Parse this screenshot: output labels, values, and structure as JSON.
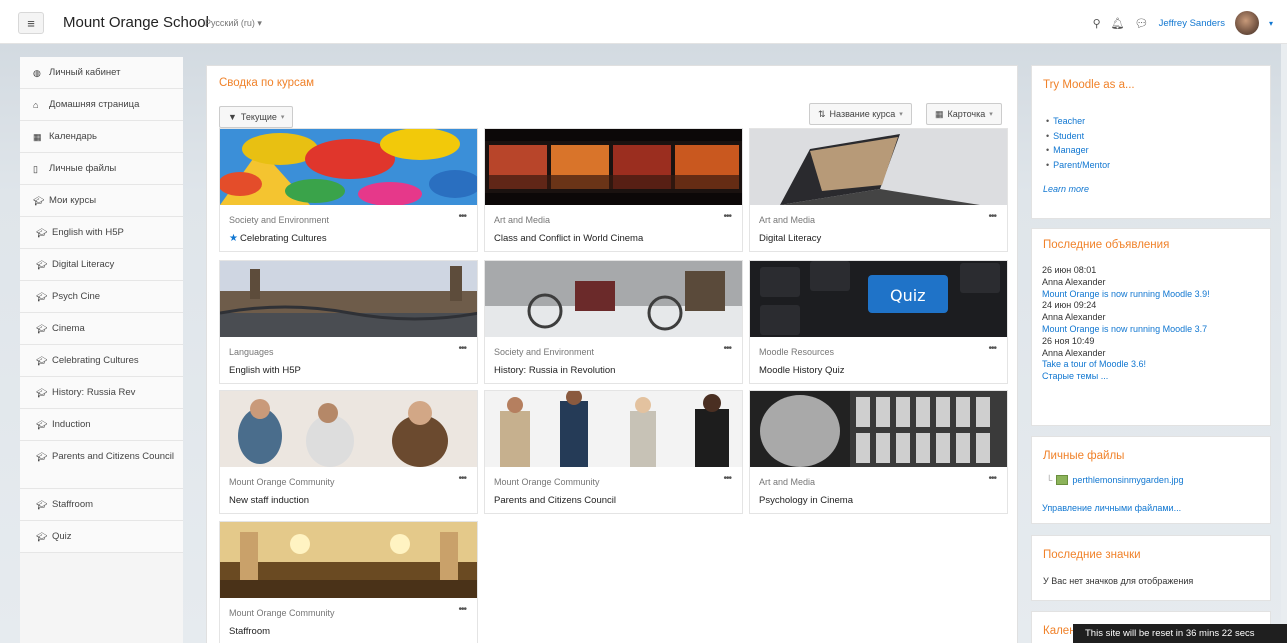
{
  "header": {
    "brand": "Mount Orange School",
    "language": "Русский (ru)",
    "username": "Jeffrey Sanders",
    "menu_icon": "hamburger-icon",
    "icons": [
      "search-icon",
      "bell-icon",
      "chat-icon"
    ]
  },
  "sidebar": {
    "items": [
      {
        "label": "Личный кабинет",
        "icon": "dashboard-icon"
      },
      {
        "label": "Домашняя страница",
        "icon": "home-icon"
      },
      {
        "label": "Календарь",
        "icon": "calendar-icon"
      },
      {
        "label": "Личные файлы",
        "icon": "file-icon"
      },
      {
        "label": "Мои курсы",
        "icon": "graduation-cap-icon"
      },
      {
        "label": "English with H5P",
        "icon": "graduation-cap-icon"
      },
      {
        "label": "Digital Literacy",
        "icon": "graduation-cap-icon"
      },
      {
        "label": "Psych Cine",
        "icon": "graduation-cap-icon"
      },
      {
        "label": "Cinema",
        "icon": "graduation-cap-icon"
      },
      {
        "label": "Celebrating Cultures",
        "icon": "graduation-cap-icon"
      },
      {
        "label": "History: Russia Rev",
        "icon": "graduation-cap-icon"
      },
      {
        "label": "Induction",
        "icon": "graduation-cap-icon"
      },
      {
        "label": "Parents and Citizens Council",
        "icon": "graduation-cap-icon"
      },
      {
        "label": "Staffroom",
        "icon": "graduation-cap-icon"
      },
      {
        "label": "Quiz",
        "icon": "graduation-cap-icon"
      }
    ]
  },
  "main": {
    "title": "Сводка по курсам",
    "filter_label": "Текущие",
    "sort_label": "Название курса",
    "view_label": "Карточка",
    "courses": [
      {
        "category": "Society and Environment",
        "name": "Celebrating Cultures",
        "starred": true
      },
      {
        "category": "Art and Media",
        "name": "Class and Conflict in World Cinema"
      },
      {
        "category": "Art and Media",
        "name": "Digital Literacy"
      },
      {
        "category": "Languages",
        "name": "English with H5P"
      },
      {
        "category": "Society and Environment",
        "name": "History: Russia in Revolution"
      },
      {
        "category": "Moodle Resources",
        "name": "Moodle History Quiz"
      },
      {
        "category": "Mount Orange Community",
        "name": "New staff induction"
      },
      {
        "category": "Mount Orange Community",
        "name": "Parents and Citizens Council"
      },
      {
        "category": "Art and Media",
        "name": "Psychology in Cinema"
      },
      {
        "category": "Mount Orange Community",
        "name": "Staffroom"
      }
    ],
    "quiz_key_label": "Quiz"
  },
  "blocks": {
    "try_moodle": {
      "title": "Try Moodle as a...",
      "roles": [
        "Teacher",
        "Student",
        "Manager",
        "Parent/Mentor"
      ],
      "learn_more": "Learn more"
    },
    "announcements": {
      "title": "Последние объявления",
      "items": [
        {
          "date": "26 июн 08:01",
          "author": "Anna Alexander",
          "subject": "Mount Orange is now running Moodle 3.9!"
        },
        {
          "date": "24 июн 09:24",
          "author": "Anna Alexander",
          "subject": "Mount Orange is now running Moodle 3.7"
        },
        {
          "date": "26 ноя 10:49",
          "author": "Anna Alexander",
          "subject": "Take a tour of Moodle 3.6!"
        }
      ],
      "older": "Старые темы ..."
    },
    "private_files": {
      "title": "Личные файлы",
      "file": "perthlemonsinmygarden.jpg",
      "manage": "Управление личными файлами..."
    },
    "badges": {
      "title": "Последние значки",
      "empty": "У Вас нет значков для отображения"
    },
    "calendar": {
      "title": "Кален"
    }
  },
  "reset_notice": "This site will be reset in 36 mins 22 secs",
  "colors": {
    "accent": "#f0822a",
    "link": "#1177d1"
  }
}
